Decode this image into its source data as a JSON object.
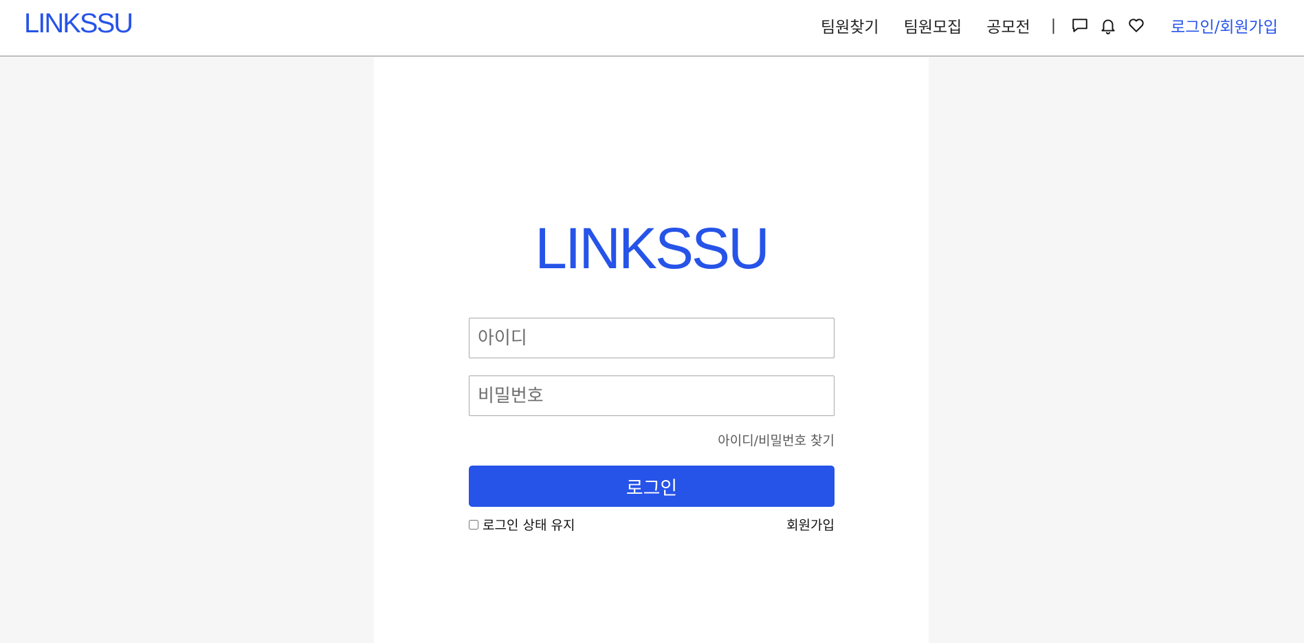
{
  "header": {
    "brand": "LINKSSU",
    "nav": [
      "팀원찾기",
      "팀원모집",
      "공모전"
    ],
    "separator": "|",
    "icons": [
      "chat-icon",
      "bell-icon",
      "heart-icon"
    ],
    "login_signup": "로그인/회원가입"
  },
  "login": {
    "logo": "LINKSSU",
    "id_placeholder": "아이디",
    "password_placeholder": "비밀번호",
    "find_account": "아이디/비밀번호 찾기",
    "login_button": "로그인",
    "keep_logged_in": "로그인 상태 유지",
    "signup": "회원가입"
  },
  "colors": {
    "accent": "#2653e8",
    "background": "#f6f6f6",
    "panel": "#ffffff"
  }
}
